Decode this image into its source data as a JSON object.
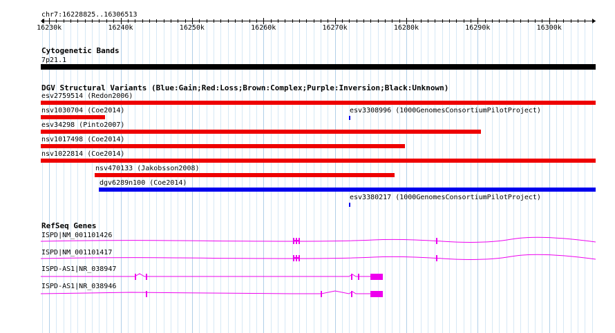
{
  "genome": {
    "start": 16228825,
    "end": 16306513
  },
  "ruler": {
    "location_label": "chr7:16228825..16306513",
    "ticks": [
      {
        "pos": 16230000,
        "label": "16230k"
      },
      {
        "pos": 16240000,
        "label": "16240k"
      },
      {
        "pos": 16250000,
        "label": "16250k"
      },
      {
        "pos": 16260000,
        "label": "16260k"
      },
      {
        "pos": 16270000,
        "label": "16270k"
      },
      {
        "pos": 16280000,
        "label": "16280k"
      },
      {
        "pos": 16290000,
        "label": "16290k"
      },
      {
        "pos": 16300000,
        "label": "16300k"
      }
    ]
  },
  "cyto": {
    "title": "Cytogenetic Bands",
    "band_label": "7p21.1",
    "color": "#000000"
  },
  "dgv": {
    "title": "DGV Structural Variants (Blue:Gain;Red:Loss;Brown:Complex;Purple:Inversion;Black:Unknown)",
    "colors": {
      "gain": "#0000ee",
      "loss": "#ee0000"
    },
    "variants": [
      {
        "id": "esv2759514",
        "label": "esv2759514 (Redon2006)",
        "start": 16228825,
        "end": 16306513,
        "type": "loss"
      },
      {
        "id": "nsv1030704",
        "label": "nsv1030704 (Coe2014)",
        "start": 16228825,
        "end": 16237850,
        "type": "loss"
      },
      {
        "id": "esv3308996",
        "label": "esv3308996 (1000GenomesConsortiumPilotProject)",
        "start": 16272000,
        "end": 16272150,
        "type": "gain"
      },
      {
        "id": "esv34298",
        "label": "esv34298 (Pinto2007)",
        "start": 16228825,
        "end": 16290450,
        "type": "loss"
      },
      {
        "id": "nsv1017498",
        "label": "nsv1017498 (Coe2014)",
        "start": 16228825,
        "end": 16279800,
        "type": "loss"
      },
      {
        "id": "nsv1022814",
        "label": "nsv1022814 (Coe2014)",
        "start": 16228825,
        "end": 16306513,
        "type": "loss"
      },
      {
        "id": "nsv470133",
        "label": "nsv470133 (Jakobsson2008)",
        "start": 16236350,
        "end": 16278350,
        "type": "loss"
      },
      {
        "id": "dgv6289n100",
        "label": "dgv6289n100 (Coe2014)",
        "start": 16237000,
        "end": 16306513,
        "type": "gain"
      },
      {
        "id": "esv3380217",
        "label": "esv3380217 (1000GenomesConsortiumPilotProject)",
        "start": 16272000,
        "end": 16272150,
        "type": "gain"
      }
    ]
  },
  "refseq": {
    "title": "RefSeq Genes",
    "color": "#ee00ee",
    "genes": [
      {
        "label": "ISPD|NM_001101426"
      },
      {
        "label": "ISPD|NM_001101417"
      },
      {
        "label": "ISPD-AS1|NR_038947"
      },
      {
        "label": "ISPD-AS1|NR_038946"
      }
    ]
  }
}
